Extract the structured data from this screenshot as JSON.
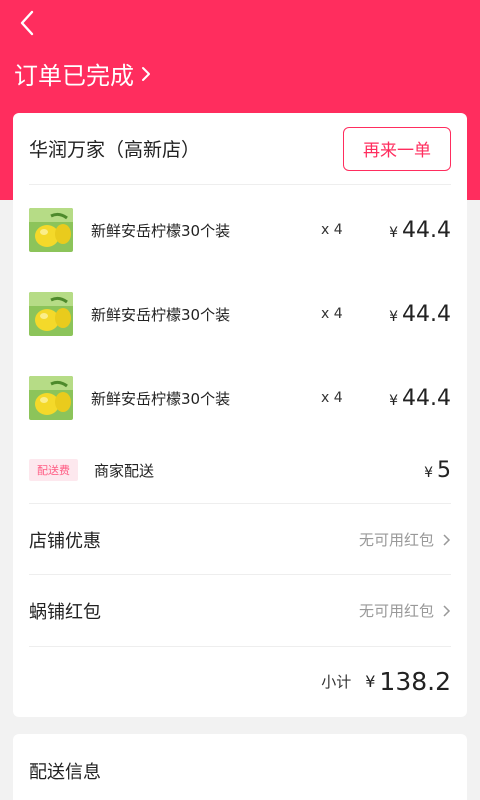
{
  "header": {
    "status_title": "订单已完成"
  },
  "store": {
    "name": "华润万家（高新店）",
    "reorder_label": "再来一单"
  },
  "items": [
    {
      "name": "新鲜安岳柠檬30个装",
      "qty": "x 4",
      "currency": "¥",
      "price": "44.4"
    },
    {
      "name": "新鲜安岳柠檬30个装",
      "qty": "x 4",
      "currency": "¥",
      "price": "44.4"
    },
    {
      "name": "新鲜安岳柠檬30个装",
      "qty": "x 4",
      "currency": "¥",
      "price": "44.4"
    }
  ],
  "delivery_fee": {
    "badge": "配送费",
    "label": "商家配送",
    "currency": "¥",
    "amount": "5"
  },
  "discounts": [
    {
      "label": "店铺优惠",
      "value": "无可用红包"
    },
    {
      "label": "蜗铺红包",
      "value": "无可用红包"
    }
  ],
  "subtotal": {
    "label": "小计",
    "currency": "¥",
    "amount": "138.2"
  },
  "delivery_info": {
    "title": "配送信息"
  },
  "colors": {
    "brand": "#ff2d5e",
    "badge_bg": "#fde8ee",
    "muted": "#999999"
  }
}
